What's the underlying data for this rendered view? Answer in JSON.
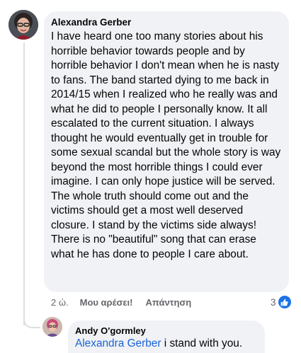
{
  "comment": {
    "author": "Alexandra Gerber",
    "text": "I have heard one too many stories about his horrible behavior towards people and by horrible behavior I don't mean when he is nasty to fans. The band started dying to me back in 2014/15 when I realized who he really was and what he did to people I personally know. It all escalated to the current situation. I always thought he would eventually get in trouble for some sexual scandal but the whole story is way beyond the most horrible things I could ever imagine. I can only hope justice will be served. The whole truth should come out and the victims should get a most well deserved closure. I stand by the victims side always! There is no \"beautiful\" song that can erase what he has done to people I care about.",
    "time": "2 ώ.",
    "like_label": "Μου αρέσει!",
    "reply_label": "Απάντηση",
    "reaction_count": "3",
    "reaction_icon": "thumbs-up-icon",
    "reaction_color": "#1b74e4"
  },
  "reply": {
    "author": "Andy O'gormley",
    "mention": "Alexandra Gerber",
    "text": " i stand with you.",
    "mention_color": "#1b63d8"
  }
}
